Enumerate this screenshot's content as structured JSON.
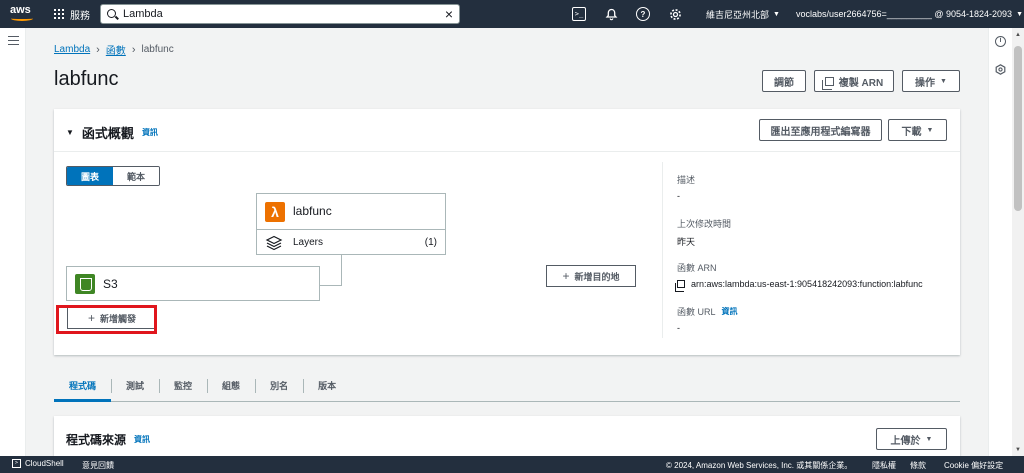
{
  "topnav": {
    "logo": "aws",
    "services_label": "服務",
    "search_value": "Lambda",
    "region": "維吉尼亞州北部",
    "account": "voclabs/user2664756=_________ @ 9054-1824-2093"
  },
  "breadcrumb": {
    "root": "Lambda",
    "functions": "函數",
    "current": "labfunc"
  },
  "page": {
    "title": "labfunc",
    "throttle_button": "調節",
    "copy_arn_button": "複製 ARN",
    "actions_button": "操作"
  },
  "overview": {
    "title": "函式概觀",
    "info_link": "資訊",
    "export_button": "匯出至應用程式編寫器",
    "download_button": "下載",
    "view_diagram": "圖表",
    "view_template": "範本",
    "function_name": "labfunc",
    "layers_label": "Layers",
    "layers_count": "(1)",
    "trigger_name": "S3",
    "add_trigger": "新增觸發",
    "add_destination": "新增目的地",
    "description_label": "描述",
    "description_value": "-",
    "last_modified_label": "上次修改時間",
    "last_modified_value": "昨天",
    "arn_label": "函數 ARN",
    "arn_value": "arn:aws:lambda:us-east-1:905418242093:function:labfunc",
    "url_label": "函數 URL",
    "url_info": "資訊",
    "url_value": "-"
  },
  "tabs": [
    "程式碼",
    "測試",
    "監控",
    "組態",
    "別名",
    "版本"
  ],
  "code_source": {
    "title": "程式碼來源",
    "info_link": "資訊",
    "upload_button": "上傳於"
  },
  "footer": {
    "cloudshell": "CloudShell",
    "feedback": "意見回饋",
    "copyright": "© 2024, Amazon Web Services, Inc. 或其關係企業。",
    "privacy": "隱私權",
    "terms": "條款",
    "cookie": "Cookie 偏好設定"
  },
  "colors": {
    "nav_bg": "#232f3e",
    "accent": "#0073bb",
    "highlight": "#e0161d",
    "lambda_orange": "#ed7100",
    "s3_green": "#3f8624"
  }
}
